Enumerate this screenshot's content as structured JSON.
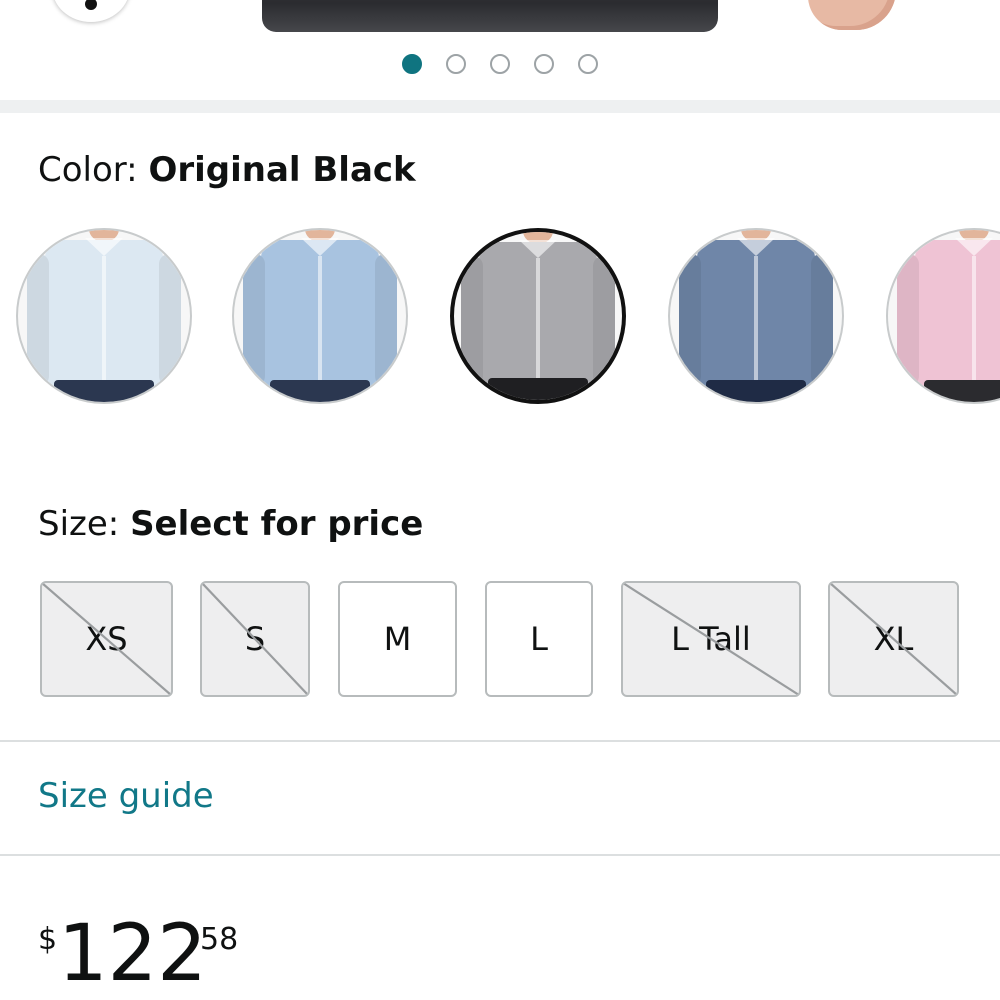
{
  "carousel": {
    "dot_count": 5,
    "active_index": 0,
    "accent_color": "#0f7480"
  },
  "color": {
    "label_prefix": "Color: ",
    "selected_name": "Original Black",
    "swatches": [
      {
        "shirt_color": "#dce8f2",
        "pants_color": "#2b3750",
        "selected": false
      },
      {
        "shirt_color": "#a8c3e0",
        "pants_color": "#2b3750",
        "selected": false
      },
      {
        "shirt_color": "#a9a9ad",
        "pants_color": "#1f1f22",
        "selected": true
      },
      {
        "shirt_color": "#6f86a8",
        "pants_color": "#1f2b45",
        "selected": false
      },
      {
        "shirt_color": "#efc3d4",
        "pants_color": "#2b2b2f",
        "selected": false
      }
    ]
  },
  "size": {
    "label_prefix": "Size: ",
    "selected_text": "Select for price",
    "options": [
      {
        "label": "XS",
        "available": false
      },
      {
        "label": "S",
        "available": false
      },
      {
        "label": "M",
        "available": true
      },
      {
        "label": "L",
        "available": true
      },
      {
        "label": "L Tall",
        "available": false
      },
      {
        "label": "XL",
        "available": false
      }
    ]
  },
  "size_guide": {
    "label": "Size guide",
    "color": "#117888"
  },
  "price": {
    "currency": "$",
    "whole": "122",
    "fraction": "58"
  }
}
